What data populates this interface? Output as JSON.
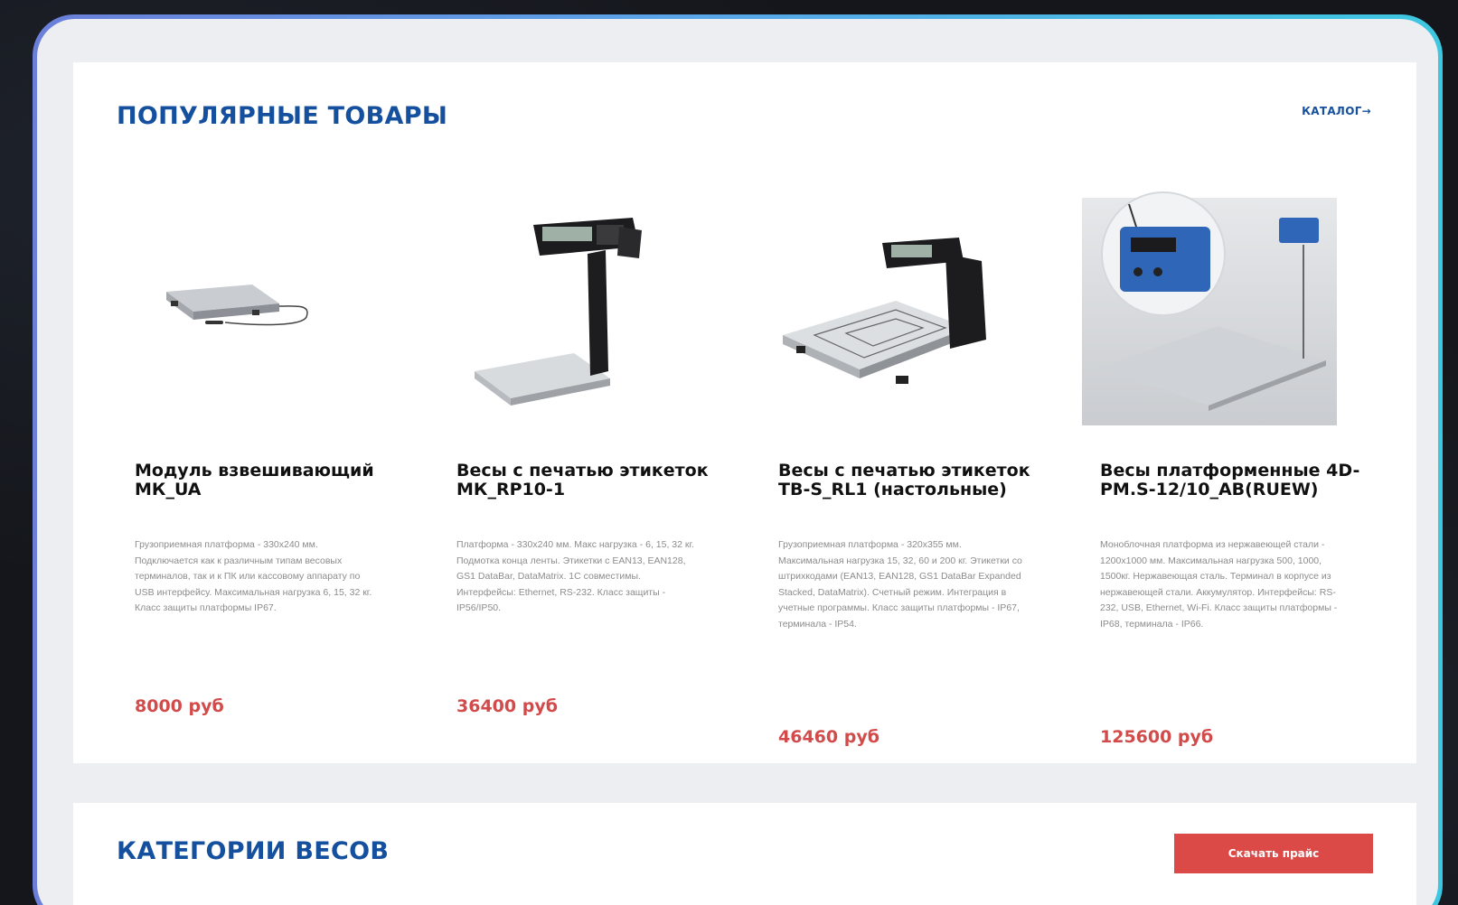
{
  "popular": {
    "title": "ПОПУЛЯРНЫЕ ТОВАРЫ",
    "catalog_link": "КАТАЛОГ→",
    "products": [
      {
        "name": "Модуль взвешивающий МК_UA",
        "image_icon": "platform-module-scale-image",
        "description": "Грузоприемная платформа - 330x240 мм. Подключается как к различным типам весовых терминалов, так и к ПК или кассовому аппарату по USB интерфейсу. Максимальная нагрузка 6, 15, 32 кг. Класс защиты платформы IP67.",
        "price": "8000 руб"
      },
      {
        "name": "Весы с печатью этикеток МК_RP10-1",
        "image_icon": "label-printing-scale-image",
        "description": "Платформа - 330х240 мм. Макс нагрузка - 6, 15, 32 кг. Подмотка конца ленты. Этикетки с EAN13, EAN128, GS1 DataBar, DataMatrix. 1С совместимы. Интерфейсы: Ethernet, RS-232. Класс защиты - IP56/IP50.",
        "price": "36400 руб"
      },
      {
        "name": "Весы с печатью этикеток ТВ-S_RL1 (настольные)",
        "image_icon": "tabletop-label-scale-image",
        "description": "Грузоприемная платформа - 320х355 мм. Максимальная нагрузка 15, 32, 60 и 200 кг. Этикетки со штрихкодами (EAN13, EAN128, GS1 DataBar Expanded Stacked, DataMatrix). Счетный режим. Интеграция в учетные программы. Класс защиты платформы - IP67, терминала - IP54.",
        "price": "46460 руб"
      },
      {
        "name": "Весы платформенные 4D-PM.S-12/10_AB(RUEW)",
        "image_icon": "floor-platform-scale-image",
        "description": "Моноблочная платформа из нержавеющей стали - 1200х1000 мм. Максимальная нагрузка 500, 1000, 1500кг. Нержавеющая сталь. Терминал в корпусе из нержавеющей стали. Аккумулятор. Интерфейсы: RS-232, USB, Ethernet, Wi-Fi. Класс защиты платформы - IP68, терминала - IP66.",
        "price": "125600 руб"
      }
    ]
  },
  "categories": {
    "title": "КАТЕГОРИИ ВЕСОВ",
    "download_button": "Скачать прайс"
  },
  "colors": {
    "accent_blue": "#15509e",
    "price_red": "#d24a4a",
    "button_red": "#dc4a48"
  }
}
